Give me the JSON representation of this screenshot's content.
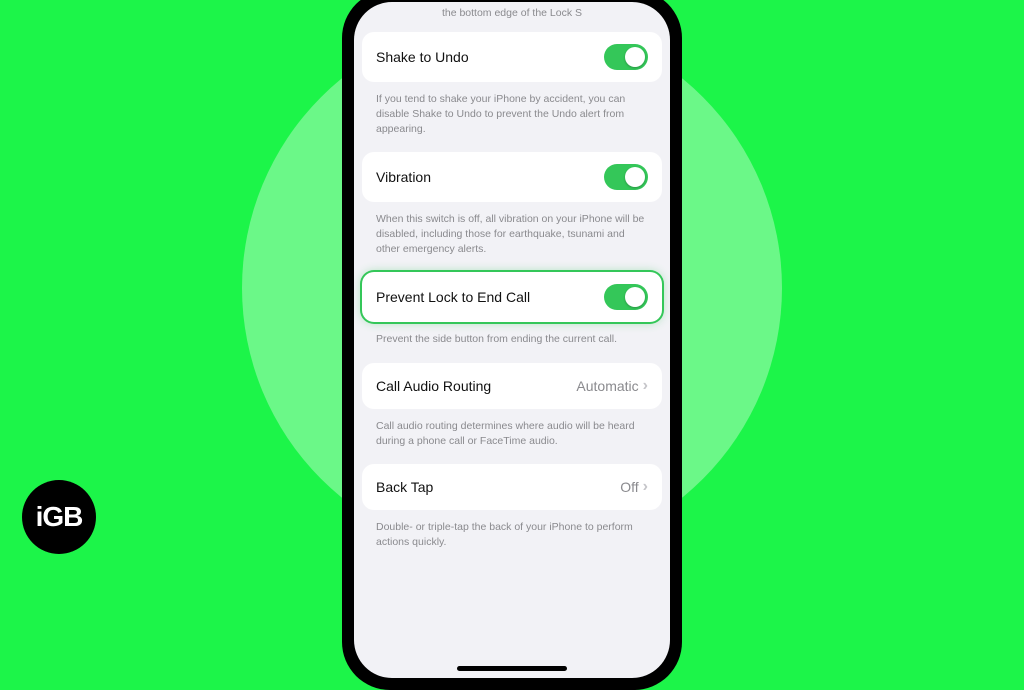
{
  "logo_text": "iGB",
  "top_fragment": "the bottom edge of the Lock S",
  "rows": {
    "shake": {
      "label": "Shake to Undo",
      "caption": "If you tend to shake your iPhone by accident, you can disable Shake to Undo to prevent the Undo alert from appearing."
    },
    "vibration": {
      "label": "Vibration",
      "caption": "When this switch is off, all vibration on your iPhone will be disabled, including those for earthquake, tsunami and other emergency alerts."
    },
    "prevent_lock": {
      "label": "Prevent Lock to End Call",
      "caption": "Prevent the side button from ending the current call."
    },
    "audio_routing": {
      "label": "Call Audio Routing",
      "value": "Automatic",
      "caption": "Call audio routing determines where audio will be heard during a phone call or FaceTime audio."
    },
    "back_tap": {
      "label": "Back Tap",
      "value": "Off",
      "caption": "Double- or triple-tap the back of your iPhone to perform actions quickly."
    }
  }
}
